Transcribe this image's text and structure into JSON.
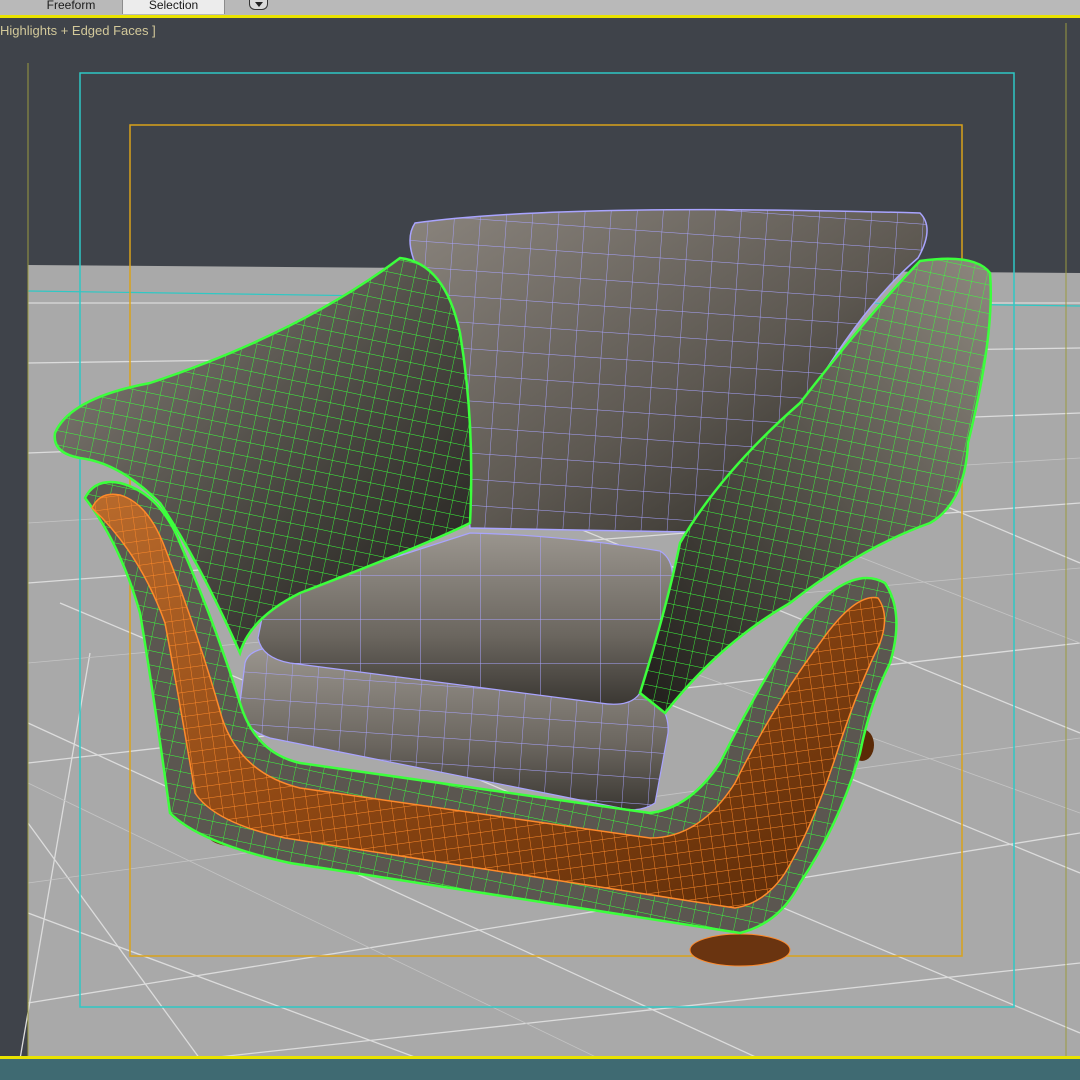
{
  "ribbon": {
    "tabs": [
      {
        "label": "Freeform",
        "active": false
      },
      {
        "label": "Selection",
        "active": true
      }
    ],
    "dropdown_icon": "chevron-down-icon"
  },
  "viewport": {
    "label": "Highlights + Edged Faces ]",
    "active_border_color": "#e9e300",
    "safe_frame_outer_color": "#2fc8c4",
    "safe_frame_inner_color": "#d9a21b",
    "horizon_color": "#2fc8c4",
    "selection_wire_color": "#3cff3c",
    "unselected_wire_color": "#a9a4ff"
  },
  "scene": {
    "object": "armchair",
    "materials": {
      "upholstery": "#6d6862",
      "wood_trim": "#9a4d16"
    }
  }
}
